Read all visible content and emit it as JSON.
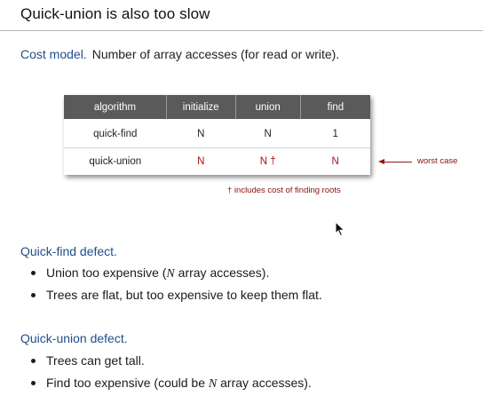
{
  "title": "Quick-union is also too slow",
  "cost_model": {
    "label": "Cost model.",
    "text": "Number of array accesses (for read or write)."
  },
  "table": {
    "headers": [
      "algorithm",
      "initialize",
      "union",
      "find"
    ],
    "rows": [
      {
        "algorithm": "quick-find",
        "initialize": "N",
        "union": "N",
        "find": "1"
      },
      {
        "algorithm": "quick-union",
        "initialize": "N",
        "union": "N †",
        "find": "N"
      }
    ],
    "highlight_color": "#b01010"
  },
  "worst_case_label": "worst case",
  "footnote": "† includes cost of finding roots",
  "quick_find_defect": {
    "heading": "Quick-find defect.",
    "bullets": [
      {
        "pre": "Union too expensive (",
        "var": "N",
        "post": " array accesses)."
      },
      {
        "text": "Trees are flat, but too expensive to keep them flat."
      }
    ]
  },
  "quick_union_defect": {
    "heading": "Quick-union defect.",
    "bullets": [
      {
        "text": "Trees can get tall."
      },
      {
        "pre": "Find too expensive (could be ",
        "var": "N",
        "post": " array accesses)."
      }
    ]
  },
  "colors": {
    "heading_blue": "#1f4e8c",
    "header_gray": "#5a5a5a",
    "annotation_red": "#8a1010"
  }
}
